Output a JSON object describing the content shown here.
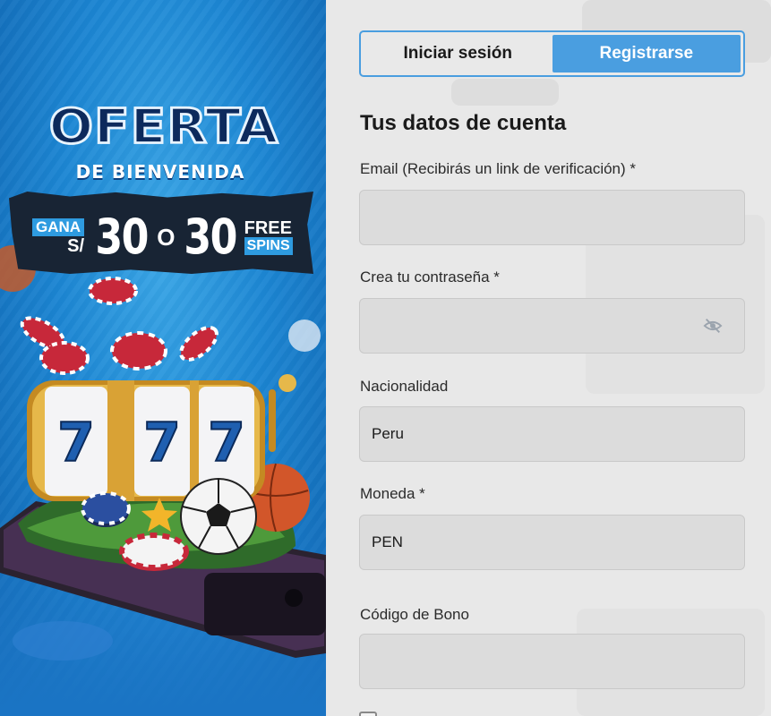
{
  "promo": {
    "headline": "OFERTA",
    "subheadline": "DE BIENVENIDA",
    "gana": "GANA",
    "currency": "S/",
    "amount": "30",
    "connector": "O",
    "spins_count": "30",
    "free": "FREE",
    "spins": "SPINS",
    "slot_digit": "7"
  },
  "tabs": {
    "login": "Iniciar sesión",
    "register": "Registrarse"
  },
  "form": {
    "section_title": "Tus datos de cuenta",
    "email_label": "Email (Recibirás un link de verificación) *",
    "email_value": "",
    "password_label": "Crea tu contraseña *",
    "password_value": "",
    "nationality_label": "Nacionalidad",
    "nationality_value": "Peru",
    "currency_label": "Moneda *",
    "currency_value": "PEN",
    "bonus_label": "Código de Bono",
    "bonus_value": ""
  },
  "icons": {
    "password_toggle": "eye-off-icon"
  },
  "colors": {
    "accent": "#4a9ee0",
    "promo_blue": "#1c86d3",
    "promo_dark": "#182434"
  }
}
